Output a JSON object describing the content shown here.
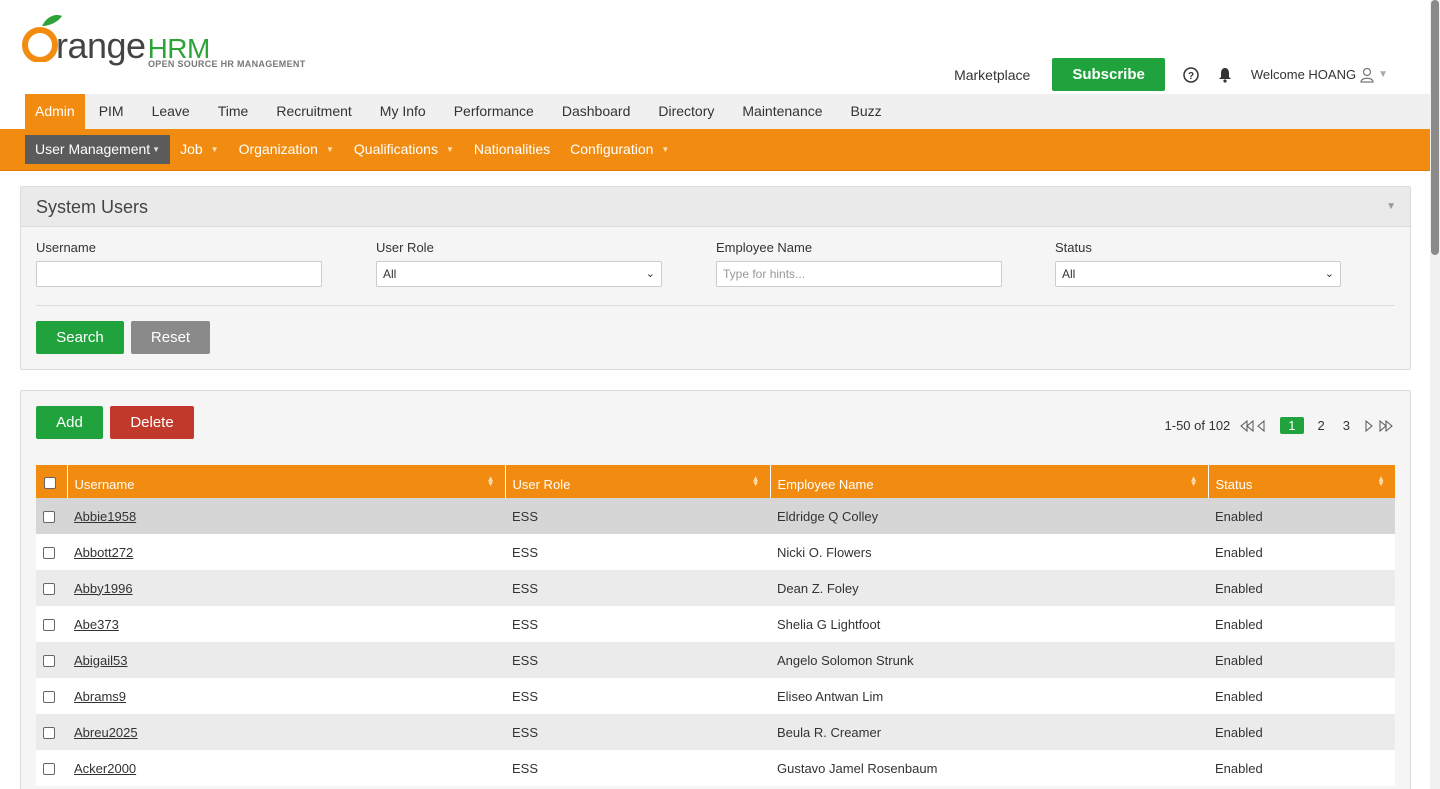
{
  "header": {
    "logo_word": "range",
    "logo_hrm": "HRM",
    "logo_tagline": "OPEN SOURCE HR MANAGEMENT",
    "marketplace": "Marketplace",
    "subscribe": "Subscribe",
    "welcome": "Welcome HOANG",
    "brand_colors": {
      "orange": "#f28c10",
      "green": "#20a33c"
    }
  },
  "main_nav": [
    "Admin",
    "PIM",
    "Leave",
    "Time",
    "Recruitment",
    "My Info",
    "Performance",
    "Dashboard",
    "Directory",
    "Maintenance",
    "Buzz"
  ],
  "sub_nav": [
    "User Management",
    "Job",
    "Organization",
    "Qualifications",
    "Nationalities",
    "Configuration"
  ],
  "search_panel": {
    "title": "System Users",
    "username_label": "Username",
    "username_value": "",
    "user_role_label": "User Role",
    "user_role_value": "All",
    "employee_label": "Employee Name",
    "employee_placeholder": "Type for hints...",
    "status_label": "Status",
    "status_value": "All",
    "search_button": "Search",
    "reset_button": "Reset"
  },
  "list_panel": {
    "add_button": "Add",
    "delete_button": "Delete",
    "pager": {
      "range": "1-50 of 102",
      "pages": [
        "1",
        "2",
        "3"
      ],
      "current": "1"
    },
    "columns": [
      "Username",
      "User Role",
      "Employee Name",
      "Status"
    ],
    "rows": [
      [
        "Abbie1958",
        "ESS",
        "Eldridge Q Colley",
        "Enabled"
      ],
      [
        "Abbott272",
        "ESS",
        "Nicki O. Flowers",
        "Enabled"
      ],
      [
        "Abby1996",
        "ESS",
        "Dean Z. Foley",
        "Enabled"
      ],
      [
        "Abe373",
        "ESS",
        "Shelia G Lightfoot",
        "Enabled"
      ],
      [
        "Abigail53",
        "ESS",
        "Angelo Solomon Strunk",
        "Enabled"
      ],
      [
        "Abrams9",
        "ESS",
        "Eliseo Antwan Lim",
        "Enabled"
      ],
      [
        "Abreu2025",
        "ESS",
        "Beula R. Creamer",
        "Enabled"
      ],
      [
        "Acker2000",
        "ESS",
        "Gustavo Jamel Rosenbaum",
        "Enabled"
      ]
    ]
  }
}
